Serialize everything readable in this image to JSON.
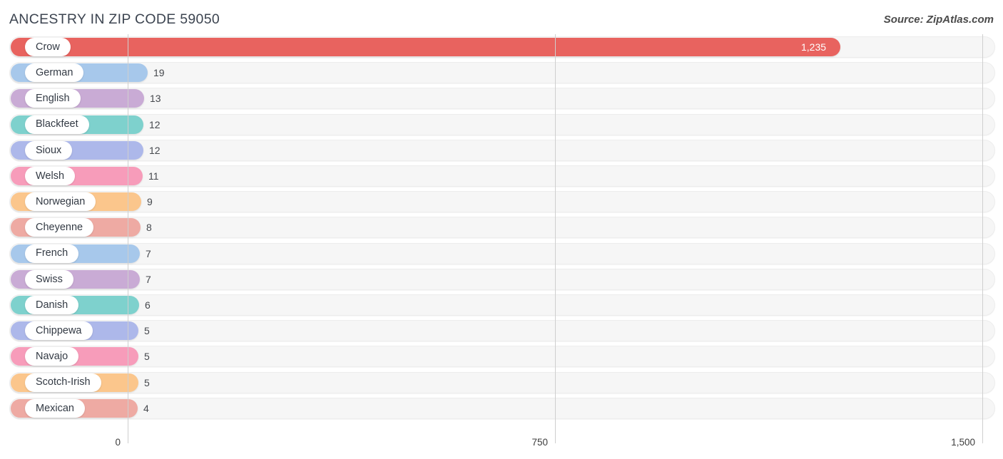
{
  "header": {
    "title": "ANCESTRY IN ZIP CODE 59050",
    "source": "Source: ZipAtlas.com"
  },
  "chart_data": {
    "type": "bar",
    "orientation": "horizontal",
    "title": "ANCESTRY IN ZIP CODE 59050",
    "xlabel": "",
    "ylabel": "",
    "xlim": [
      0,
      1500
    ],
    "ticks": [
      "0",
      "750",
      "1,500"
    ],
    "tick_values": [
      0,
      750,
      1500
    ],
    "grid": true,
    "legend": "none",
    "categories": [
      "Crow",
      "German",
      "English",
      "Blackfeet",
      "Sioux",
      "Welsh",
      "Norwegian",
      "Cheyenne",
      "French",
      "Swiss",
      "Danish",
      "Chippewa",
      "Navajo",
      "Scotch-Irish",
      "Mexican"
    ],
    "values": [
      1235,
      19,
      13,
      12,
      12,
      11,
      9,
      8,
      7,
      7,
      6,
      5,
      5,
      5,
      4
    ],
    "value_labels": [
      "1,235",
      "19",
      "13",
      "12",
      "12",
      "11",
      "9",
      "8",
      "7",
      "7",
      "6",
      "5",
      "5",
      "5",
      "4"
    ],
    "colors": [
      "#e8635f",
      "#a7c8eb",
      "#c9abd5",
      "#7ed1cd",
      "#adb8ea",
      "#f79cba",
      "#fbc68c",
      "#eeaaa3",
      "#a7c8eb",
      "#c9abd5",
      "#7ed1cd",
      "#adb8ea",
      "#f79cba",
      "#fbc68c",
      "#eeaaa3"
    ],
    "bars": [
      {
        "label": "Crow",
        "value": 1235,
        "display": "1,235",
        "color": "#e8635f",
        "bar_end": 1178,
        "label_inside": true
      },
      {
        "label": "German",
        "value": 19,
        "display": "19",
        "color": "#a7c8eb",
        "bar_end": 207,
        "label_inside": false
      },
      {
        "label": "English",
        "value": 13,
        "display": "13",
        "color": "#c9abd5",
        "bar_end": 202,
        "label_inside": false
      },
      {
        "label": "Blackfeet",
        "value": 12,
        "display": "12",
        "color": "#7ed1cd",
        "bar_end": 201,
        "label_inside": false
      },
      {
        "label": "Sioux",
        "value": 12,
        "display": "12",
        "color": "#adb8ea",
        "bar_end": 201,
        "label_inside": false
      },
      {
        "label": "Welsh",
        "value": 11,
        "display": "11",
        "color": "#f79cba",
        "bar_end": 200,
        "label_inside": false
      },
      {
        "label": "Norwegian",
        "value": 9,
        "display": "9",
        "color": "#fbc68c",
        "bar_end": 198,
        "label_inside": false
      },
      {
        "label": "Cheyenne",
        "value": 8,
        "display": "8",
        "color": "#eeaaa3",
        "bar_end": 197,
        "label_inside": false
      },
      {
        "label": "French",
        "value": 7,
        "display": "7",
        "color": "#a7c8eb",
        "bar_end": 196,
        "label_inside": false
      },
      {
        "label": "Swiss",
        "value": 7,
        "display": "7",
        "color": "#c9abd5",
        "bar_end": 196,
        "label_inside": false
      },
      {
        "label": "Danish",
        "value": 6,
        "display": "6",
        "color": "#7ed1cd",
        "bar_end": 195,
        "label_inside": false
      },
      {
        "label": "Chippewa",
        "value": 5,
        "display": "5",
        "color": "#adb8ea",
        "bar_end": 194,
        "label_inside": false
      },
      {
        "label": "Navajo",
        "value": 5,
        "display": "5",
        "color": "#f79cba",
        "bar_end": 194,
        "label_inside": false
      },
      {
        "label": "Scotch-Irish",
        "value": 5,
        "display": "5",
        "color": "#fbc68c",
        "bar_end": 194,
        "label_inside": false
      },
      {
        "label": "Mexican",
        "value": 4,
        "display": "4",
        "color": "#eeaaa3",
        "bar_end": 193,
        "label_inside": false
      }
    ]
  },
  "axis": {
    "ticks": [
      {
        "label": "0",
        "x": 179
      },
      {
        "label": "750",
        "x": 778
      },
      {
        "label": "1,500",
        "x": 1377
      }
    ]
  }
}
